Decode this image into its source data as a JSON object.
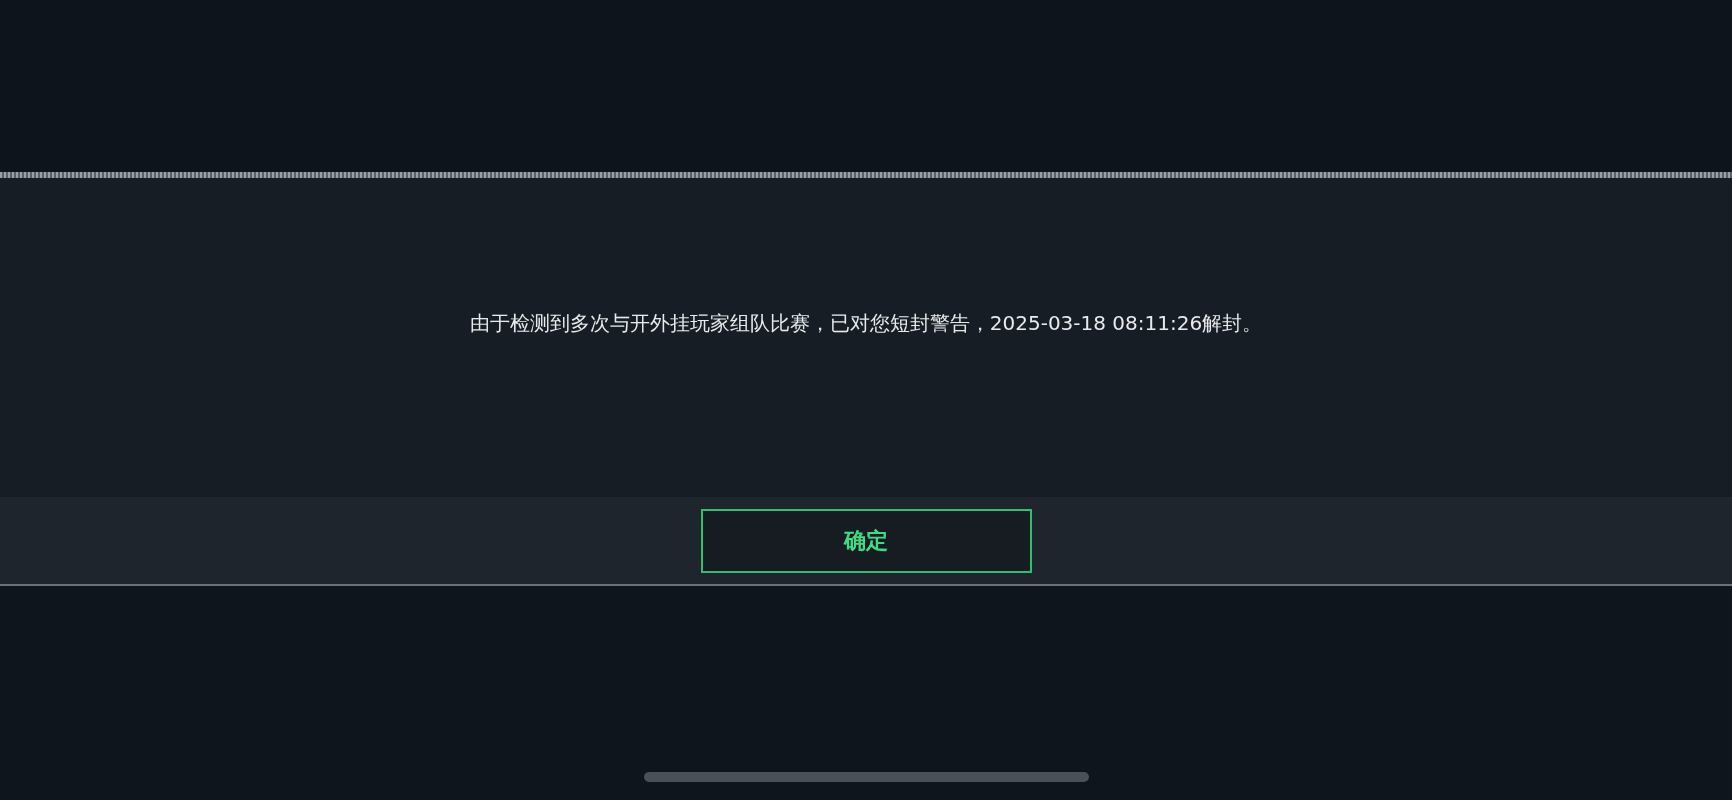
{
  "dialog": {
    "message": "由于检测到多次与开外挂玩家组队比赛，已对您短封警告，2025-03-18 08:11:26解封。",
    "confirm_button": "确定"
  }
}
